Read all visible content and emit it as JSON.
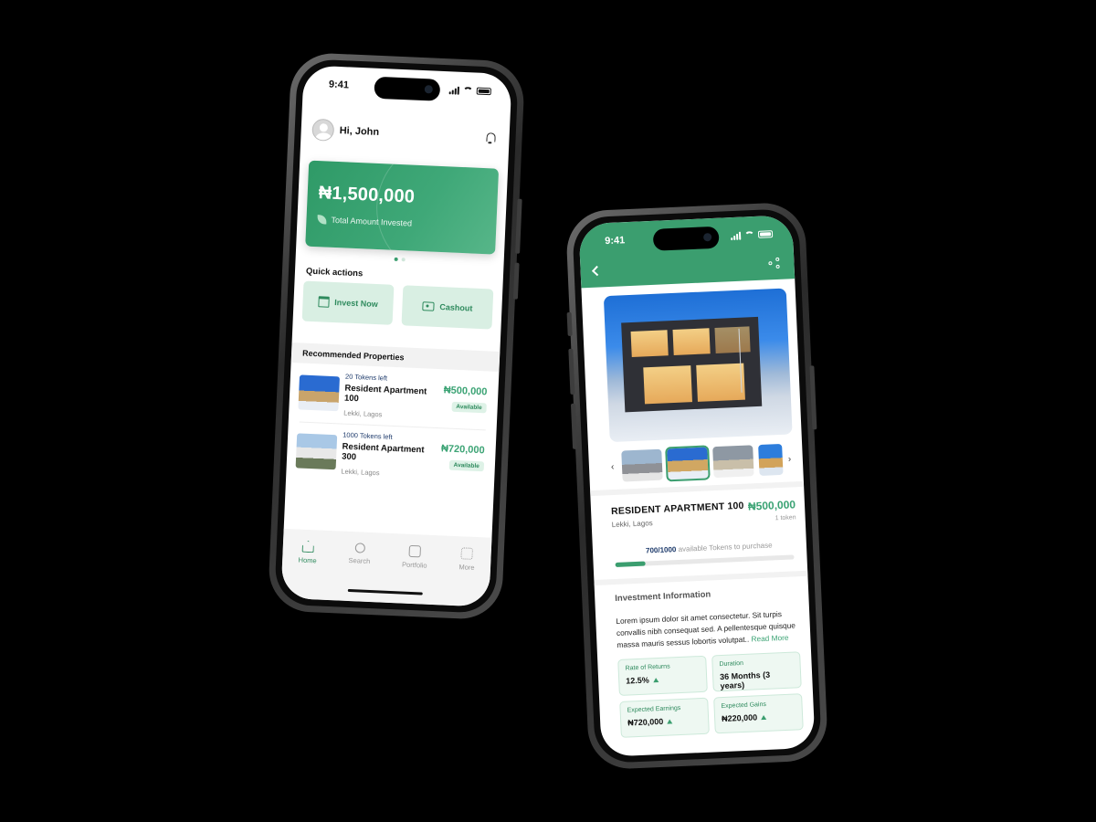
{
  "phone1": {
    "status_time": "9:41",
    "greeting": "Hi, John",
    "balance": {
      "amount": "₦1,500,000",
      "label": "Total Amount Invested"
    },
    "quick_actions_title": "Quick actions",
    "quick_actions": [
      {
        "label": "Invest Now",
        "icon": "building-icon"
      },
      {
        "label": "Cashout",
        "icon": "cash-icon"
      }
    ],
    "recommended_title": "Recommended Properties",
    "properties": [
      {
        "tokens": "20 Tokens left",
        "name": "Resident Apartment 100",
        "location": "Lekki, Lagos",
        "price": "₦500,000",
        "status": "Available"
      },
      {
        "tokens": "1000 Tokens left",
        "name": "Resident Apartment 300",
        "location": "Lekki, Lagos",
        "price": "₦720,000",
        "status": "Available"
      }
    ],
    "tabs": [
      {
        "label": "Home",
        "icon": "home-icon",
        "active": true
      },
      {
        "label": "Search",
        "icon": "search-icon",
        "active": false
      },
      {
        "label": "Portfolio",
        "icon": "portfolio-icon",
        "active": false
      },
      {
        "label": "More",
        "icon": "grid-icon",
        "active": false
      }
    ]
  },
  "phone2": {
    "status_time": "9:41",
    "title": "RESIDENT APARTMENT 100",
    "location": "Lekki, Lagos",
    "price": "₦500,000",
    "price_unit": "1 token",
    "tokens_available": "700/1000",
    "tokens_available_text": "available Tokens to purchase",
    "tokens_progress": 0.17,
    "investment_title": "Investment Information",
    "description": "Lorem ipsum dolor sit amet consectetur. Sit turpis convallis nibh consequat sed. A pellentesque quisque massa mauris sessus lobortis volutpat..",
    "read_more": "Read More",
    "stats": [
      {
        "label": "Rate of Returns",
        "value": "12.5%",
        "trend": "up"
      },
      {
        "label": "Duration",
        "value": "36 Months (3 years)",
        "trend": ""
      },
      {
        "label": "Expected Earnings",
        "value": "₦720,000",
        "trend": "up"
      },
      {
        "label": "Expected Gains",
        "value": "₦220,000",
        "trend": "up"
      }
    ]
  },
  "colors": {
    "accent": "#3b9e6f",
    "accent_light": "#d9efe3",
    "background": "#000000"
  }
}
